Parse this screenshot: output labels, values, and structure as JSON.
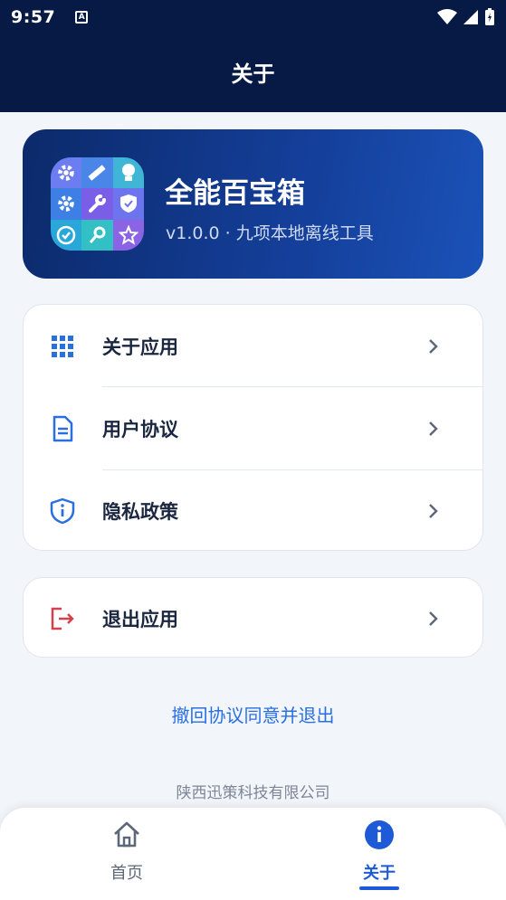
{
  "status_bar": {
    "time": "9:57",
    "notification_letter": "A"
  },
  "header": {
    "title": "关于"
  },
  "app_card": {
    "name": "全能百宝箱",
    "subtitle": "v1.0.0 · 九项本地离线工具"
  },
  "menu": {
    "items": [
      {
        "label": "关于应用",
        "icon": "grid-icon"
      },
      {
        "label": "用户协议",
        "icon": "document-icon"
      },
      {
        "label": "隐私政策",
        "icon": "shield-info-icon"
      }
    ]
  },
  "exit": {
    "label": "退出应用",
    "icon": "logout-icon"
  },
  "revoke_link": "撤回协议同意并退出",
  "company": "陕西迅策科技有限公司",
  "bottom_nav": {
    "items": [
      {
        "label": "首页",
        "icon": "home-icon",
        "active": false
      },
      {
        "label": "关于",
        "icon": "info-icon",
        "active": true
      }
    ]
  },
  "colors": {
    "header_bg": "#071a45",
    "accent": "#1e5ad8",
    "exit_red": "#d6404a"
  }
}
